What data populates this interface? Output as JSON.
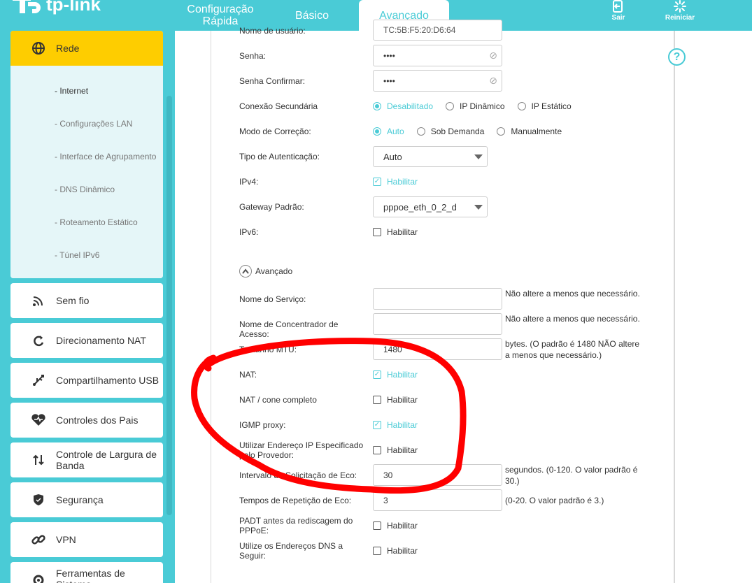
{
  "header": {
    "logo_text": "tp-link",
    "tabs": [
      {
        "label_line1": "Configuração",
        "label_line2": "Rápida"
      },
      {
        "label": "Básico"
      },
      {
        "label": "Avançado"
      }
    ],
    "logout_label": "Sair",
    "reboot_label": "Reiniciar"
  },
  "sidebar": {
    "rede": {
      "label": "Rede",
      "subitems": [
        "- Internet",
        "- Configurações LAN",
        "- Interface de Agrupamento",
        "- DNS Dinâmico",
        "- Roteamento Estático",
        "- Túnel IPv6"
      ]
    },
    "items": [
      {
        "label": "Sem fio",
        "icon": "wifi-icon"
      },
      {
        "label": "Direcionamento NAT",
        "icon": "nat-icon"
      },
      {
        "label": "Compartilhamento USB",
        "icon": "usb-icon"
      },
      {
        "label": "Controles dos Pais",
        "icon": "heart-icon"
      },
      {
        "label": "Controle de Largura de Banda",
        "icon": "bandwidth-icon"
      },
      {
        "label": "Segurança",
        "icon": "shield-icon"
      },
      {
        "label": "VPN",
        "icon": "link-icon"
      },
      {
        "label": "Ferramentas de Sistema",
        "icon": "gear-icon"
      }
    ]
  },
  "form": {
    "username": {
      "label": "Nome de usuário:",
      "value": "TC:5B:F5:20:D6:64"
    },
    "password": {
      "label": "Senha:",
      "value": "••••"
    },
    "password_confirm": {
      "label": "Senha Confirmar:",
      "value": "••••"
    },
    "secondary_conn": {
      "label": "Conexão Secundária",
      "options": [
        "Desabilitado",
        "IP Dinâmico",
        "IP Estático"
      ],
      "selected": "Desabilitado"
    },
    "correction_mode": {
      "label": "Modo de Correção:",
      "options": [
        "Auto",
        "Sob Demanda",
        "Manualmente"
      ],
      "selected": "Auto"
    },
    "auth_type": {
      "label": "Tipo de Autenticação:",
      "value": "Auto"
    },
    "ipv4": {
      "label": "IPv4:",
      "option": "Habilitar",
      "checked": true
    },
    "default_gateway": {
      "label": "Gateway Padrão:",
      "value": "pppoe_eth_0_2_d"
    },
    "ipv6": {
      "label": "IPv6:",
      "option": "Habilitar",
      "checked": false
    },
    "advanced_toggle": "Avançado",
    "service_name": {
      "label": "Nome do Serviço:",
      "value": "",
      "note": "Não altere a menos que necessário."
    },
    "access_concentrator": {
      "label": "Nome de Concentrador de Acesso:",
      "value": "",
      "note": "Não altere a menos que necessário."
    },
    "mtu": {
      "label": "Tamanho MTU:",
      "value": "1480",
      "note": "bytes. (O padrão é 1480 NÃO altere a menos que necessário.)"
    },
    "nat": {
      "label": "NAT:",
      "option": "Habilitar",
      "checked": true
    },
    "nat_full_cone": {
      "label": "NAT / cone completo",
      "option": "Habilitar",
      "checked": false
    },
    "igmp_proxy": {
      "label": "IGMP proxy:",
      "option": "Habilitar",
      "checked": true
    },
    "isp_ip": {
      "label": "Utilizar Endereço IP Especificado pelo Provedor:",
      "option": "Habilitar",
      "checked": false
    },
    "echo_interval": {
      "label": "Intervalo de Solicitação de Eco:",
      "value": "30",
      "note": "segundos. (0-120. O valor padrão é 30.)"
    },
    "echo_retries": {
      "label": "Tempos de Repetição de Eco:",
      "value": "3",
      "note": "(0-20. O valor padrão é 3.)"
    },
    "padt": {
      "label": "PADT antes da rediscagem do PPPoE:",
      "option": "Habilitar",
      "checked": false
    },
    "use_dns": {
      "label": "Utilize os Endereços DNS a Seguir:",
      "option": "Habilitar",
      "checked": false
    }
  },
  "colors": {
    "accent": "#4acbd6",
    "active_menu": "#fecd00",
    "annotation": "#ff0000"
  }
}
